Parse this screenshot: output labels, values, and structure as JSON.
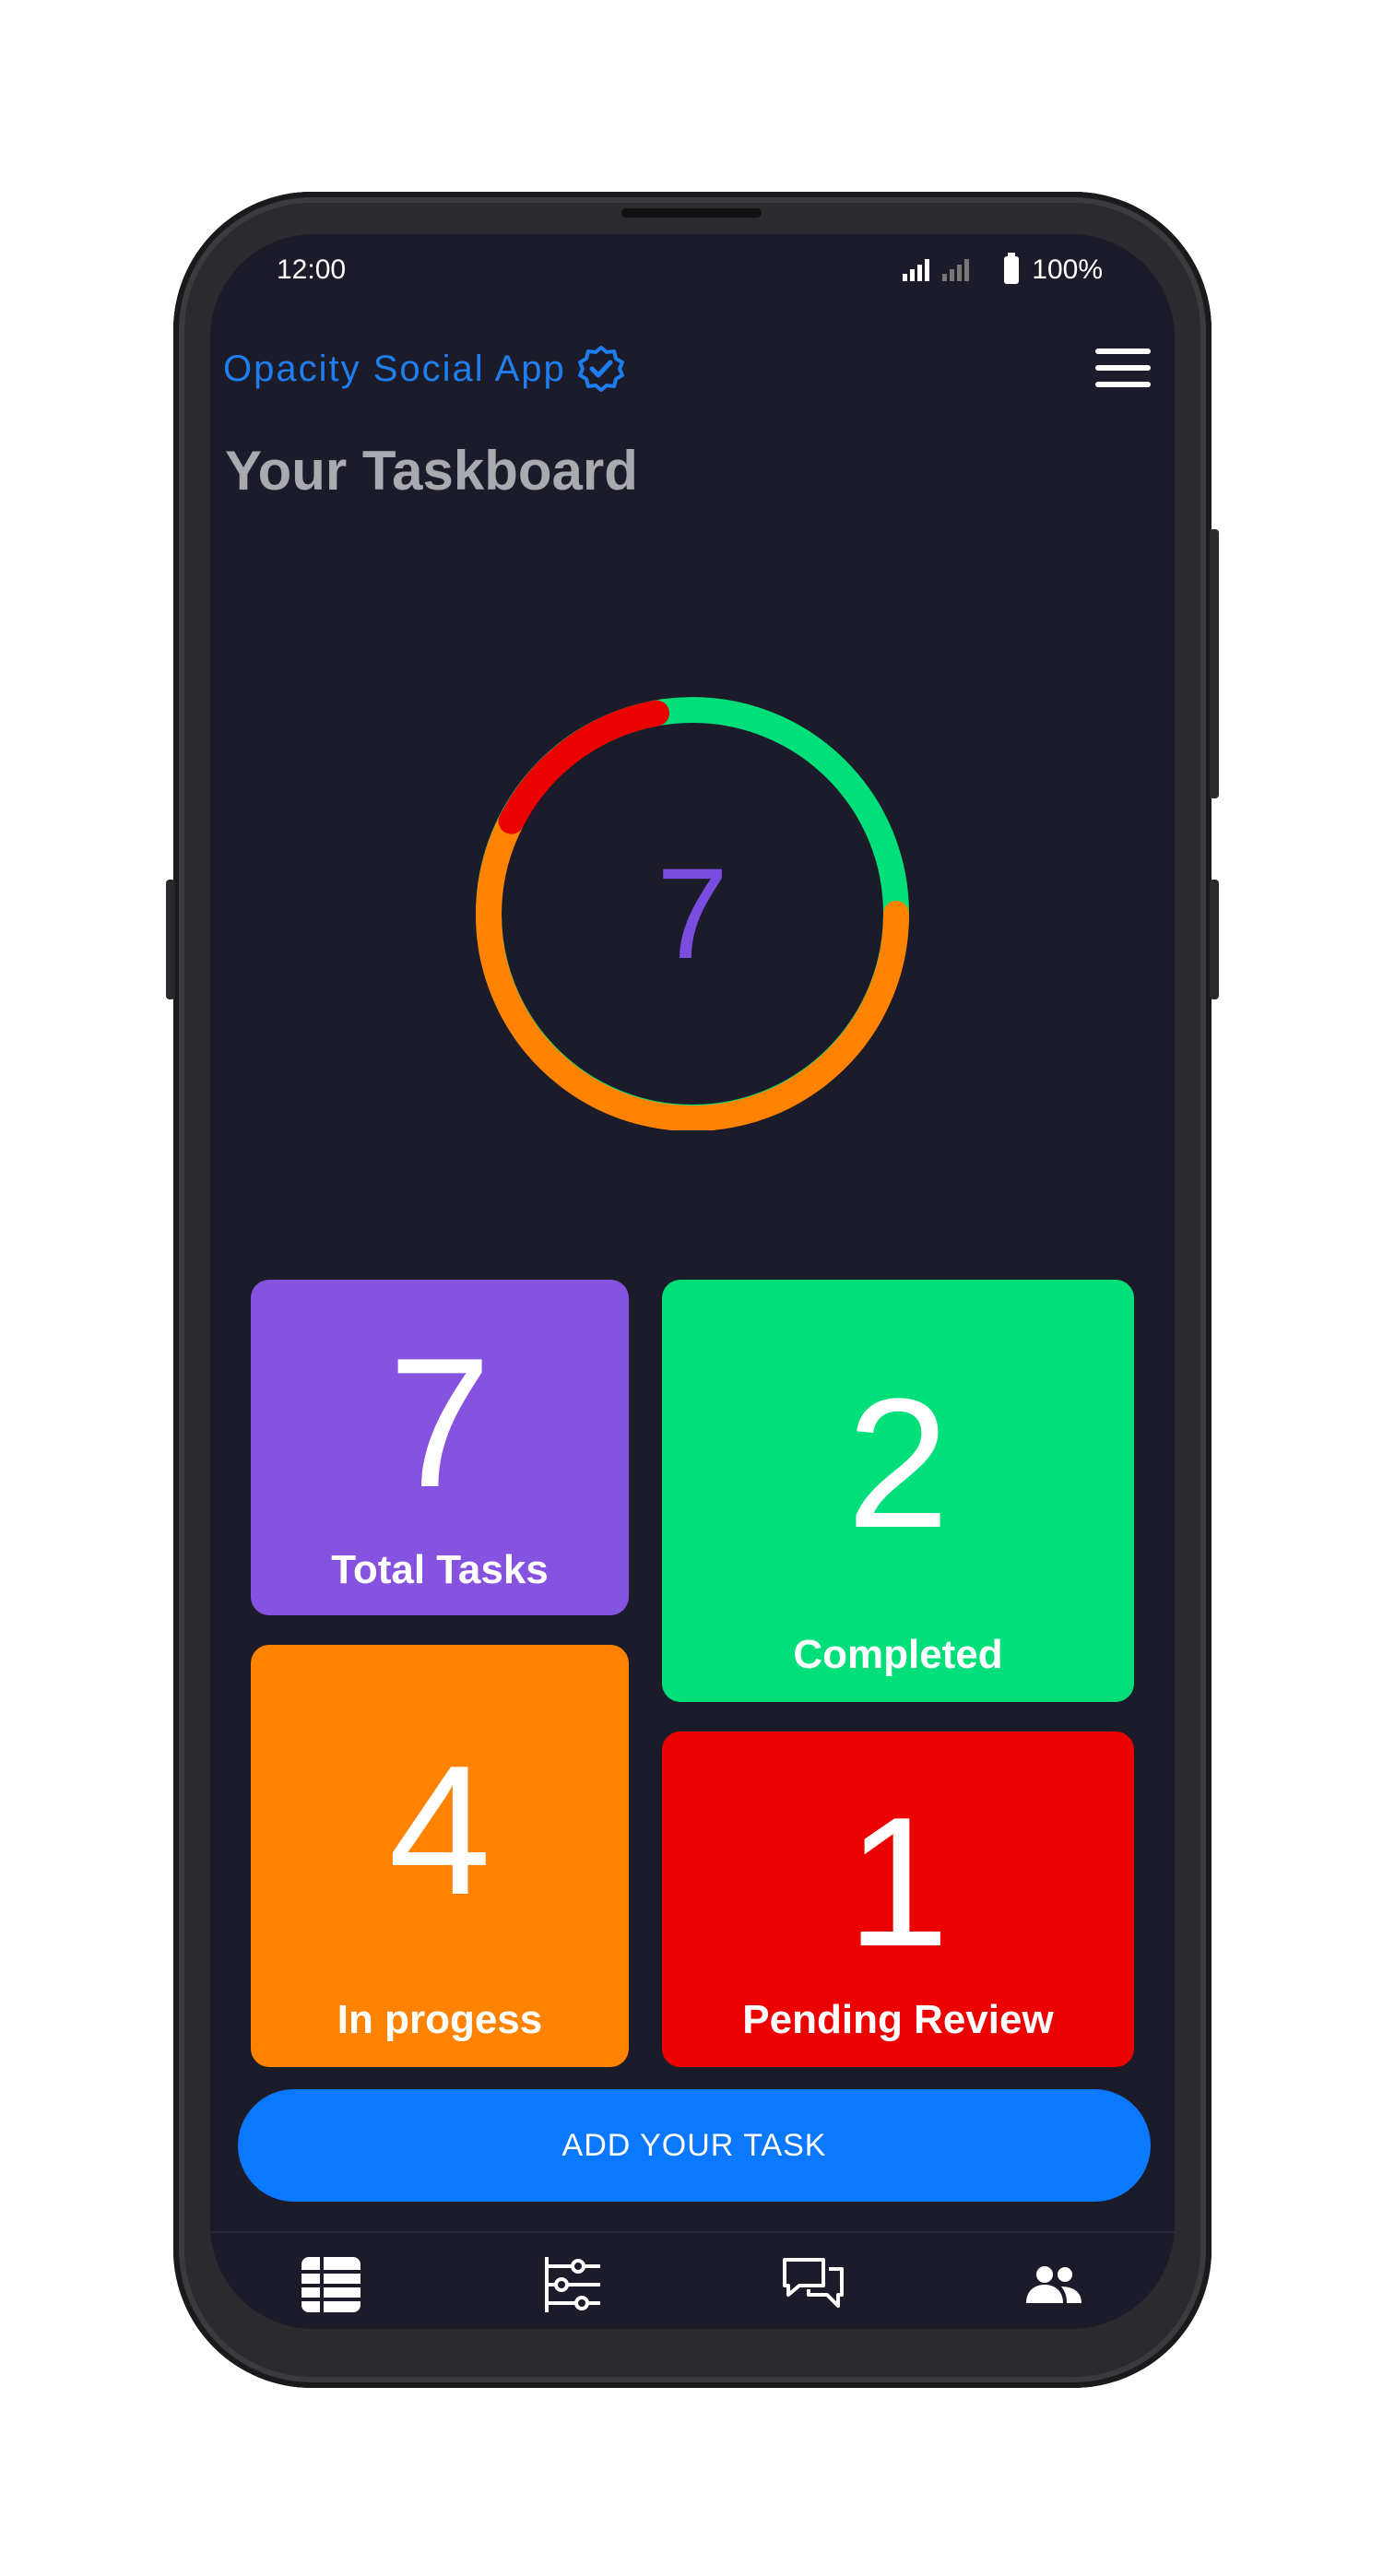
{
  "status": {
    "time": "12:00",
    "battery": "100%"
  },
  "header": {
    "brand": "Opacity Social App",
    "title": "Your Taskboard"
  },
  "ring": {
    "count": "7",
    "completed": 2,
    "in_progress": 4,
    "pending": 1,
    "colors": {
      "completed": "#00df7a",
      "in_progress": "#ff8200",
      "pending": "#ec0000"
    }
  },
  "cards": {
    "total": {
      "value": "7",
      "label": "Total Tasks",
      "color": "#8553e0"
    },
    "completed": {
      "value": "2",
      "label": "Completed",
      "color": "#00df7a"
    },
    "in_progress": {
      "value": "4",
      "label": "In progess",
      "color": "#ff8200"
    },
    "pending": {
      "value": "1",
      "label": "Pending Review",
      "color": "#ec0000"
    }
  },
  "actions": {
    "add_task": "ADD YOUR TASK"
  },
  "nav": [
    {
      "icon": "table-icon"
    },
    {
      "icon": "sliders-icon"
    },
    {
      "icon": "chat-icon"
    },
    {
      "icon": "people-icon"
    }
  ]
}
